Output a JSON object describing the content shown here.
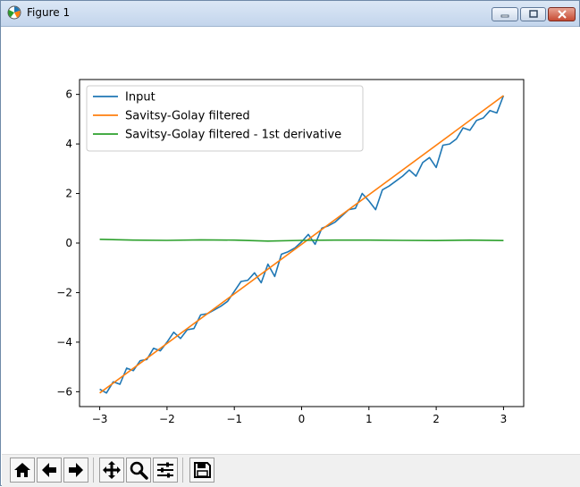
{
  "window": {
    "title": "Figure 1",
    "icons": {
      "app": "matplotlib-figure-icon",
      "minimize": "minimize-icon",
      "maximize": "maximize-icon",
      "close": "close-icon"
    }
  },
  "toolbar": {
    "buttons": [
      "home-icon",
      "back-arrow-icon",
      "forward-arrow-icon",
      "pan-icon",
      "zoom-icon",
      "configure-subplots-icon",
      "save-icon"
    ]
  },
  "colors": {
    "input": "#1f77b4",
    "filtered": "#ff7f0e",
    "derivative": "#2ca02c"
  },
  "chart_data": {
    "type": "line",
    "title": "",
    "xlabel": "",
    "ylabel": "",
    "xlim": [
      -3.3,
      3.3
    ],
    "ylim": [
      -6.6,
      6.6
    ],
    "xticks": [
      -3,
      -2,
      -1,
      0,
      1,
      2,
      3
    ],
    "xtick_labels": [
      "−3",
      "−2",
      "−1",
      "0",
      "1",
      "2",
      "3"
    ],
    "yticks": [
      -6,
      -4,
      -2,
      0,
      2,
      4,
      6
    ],
    "ytick_labels": [
      "−6",
      "−4",
      "−2",
      "0",
      "2",
      "4",
      "6"
    ],
    "grid": false,
    "legend_position": "upper-left",
    "series": [
      {
        "name": "Input",
        "color": "#1f77b4",
        "x": [
          -3.0,
          -2.9,
          -2.8,
          -2.7,
          -2.6,
          -2.5,
          -2.4,
          -2.3,
          -2.2,
          -2.1,
          -2.0,
          -1.9,
          -1.8,
          -1.7,
          -1.6,
          -1.5,
          -1.4,
          -1.3,
          -1.2,
          -1.1,
          -1.0,
          -0.9,
          -0.8,
          -0.7,
          -0.6,
          -0.5,
          -0.4,
          -0.3,
          -0.2,
          -0.1,
          0.0,
          0.1,
          0.2,
          0.3,
          0.4,
          0.5,
          0.6,
          0.7,
          0.8,
          0.9,
          1.0,
          1.1,
          1.2,
          1.3,
          1.4,
          1.5,
          1.6,
          1.7,
          1.8,
          1.9,
          2.0,
          2.1,
          2.2,
          2.3,
          2.4,
          2.5,
          2.6,
          2.7,
          2.8,
          2.9,
          3.0
        ],
        "y": [
          -5.9,
          -6.05,
          -5.6,
          -5.7,
          -5.05,
          -5.15,
          -4.75,
          -4.7,
          -4.25,
          -4.35,
          -4.0,
          -3.6,
          -3.85,
          -3.5,
          -3.45,
          -2.9,
          -2.85,
          -2.7,
          -2.55,
          -2.35,
          -1.95,
          -1.55,
          -1.5,
          -1.2,
          -1.6,
          -0.85,
          -1.35,
          -0.45,
          -0.35,
          -0.2,
          0.05,
          0.35,
          -0.05,
          0.6,
          0.7,
          0.85,
          1.1,
          1.35,
          1.4,
          2.0,
          1.7,
          1.35,
          2.15,
          2.3,
          2.5,
          2.7,
          2.95,
          2.7,
          3.25,
          3.45,
          3.05,
          3.95,
          4.0,
          4.2,
          4.65,
          4.55,
          4.95,
          5.05,
          5.35,
          5.25,
          5.95
        ]
      },
      {
        "name": "Savitsy-Golay filtered",
        "color": "#ff7f0e",
        "x": [
          -3.0,
          3.0
        ],
        "y": [
          -6.05,
          5.95
        ]
      },
      {
        "name": "Savitsy-Golay filtered - 1st derivative",
        "color": "#2ca02c",
        "x": [
          -3.0,
          -2.5,
          -2.0,
          -1.5,
          -1.0,
          -0.5,
          0.0,
          0.5,
          1.0,
          1.5,
          2.0,
          2.5,
          3.0
        ],
        "y": [
          0.15,
          0.12,
          0.11,
          0.13,
          0.12,
          0.08,
          0.11,
          0.12,
          0.12,
          0.11,
          0.1,
          0.12,
          0.1
        ]
      }
    ]
  }
}
